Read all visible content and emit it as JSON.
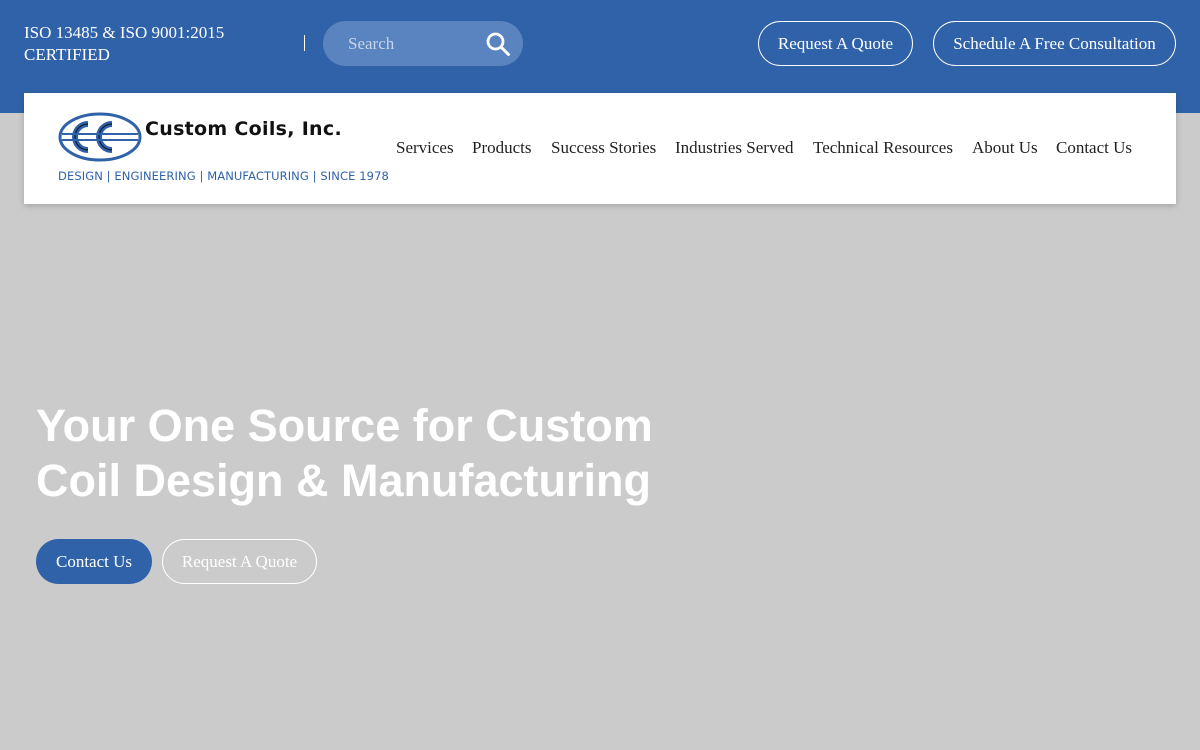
{
  "topbar": {
    "certification": "ISO 13485 & ISO 9001:2015 CERTIFIED",
    "search": {
      "placeholder": "Search",
      "value": ""
    },
    "quote_button": "Request A Quote",
    "consult_button": "Schedule A Free Consultation"
  },
  "header": {
    "logo_name": "Custom Coils, Inc.",
    "logo_tagline": "DESIGN | ENGINEERING | MANUFACTURING | SINCE 1978",
    "nav": [
      "Services",
      "Products",
      "Success Stories",
      "Industries Served",
      "Technical Resources",
      "About Us",
      "Contact Us"
    ]
  },
  "hero": {
    "title_line1": "Your One Source for Custom",
    "title_line2": "Coil Design & Manufacturing",
    "contact_button": "Contact Us",
    "quote_button": "Request A Quote"
  },
  "colors": {
    "brand_blue": "#2f62a8",
    "hero_background": "#cbcbcb"
  },
  "icons": {
    "search": "search-icon",
    "logo": "cc-logo-icon"
  }
}
